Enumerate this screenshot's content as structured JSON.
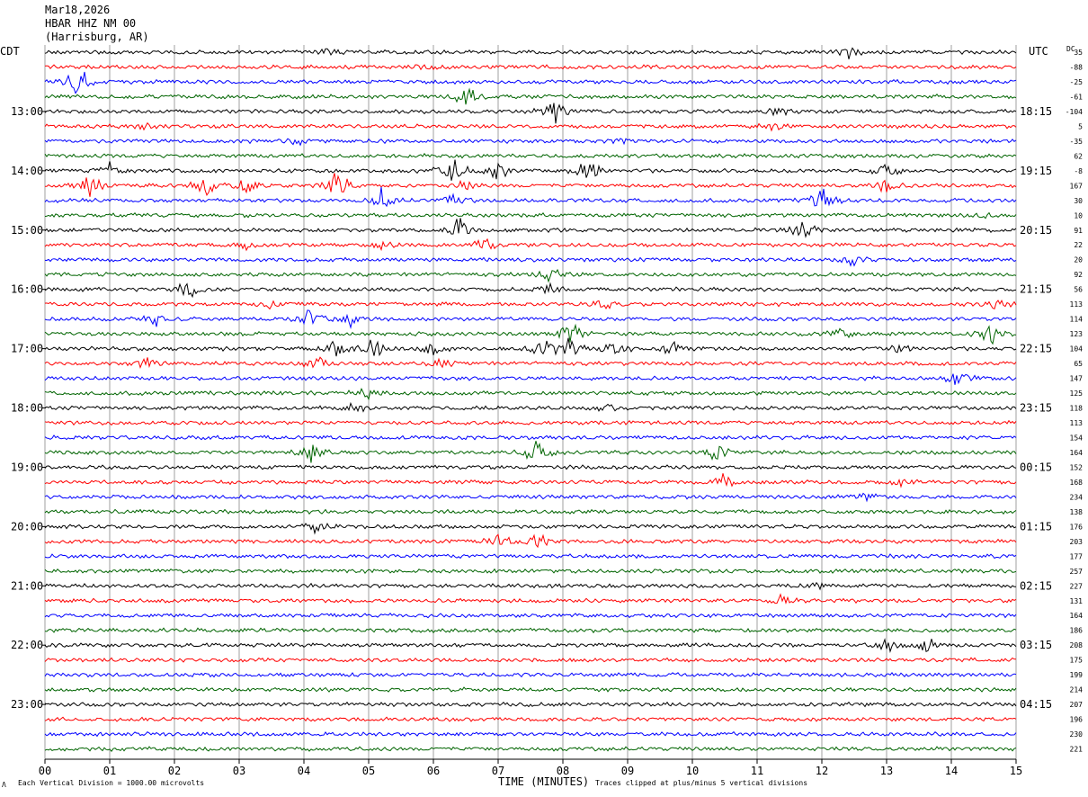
{
  "header": {
    "date": "Mar18,2026",
    "station": "HBAR HHZ NM 00",
    "location": "(Harrisburg, AR)"
  },
  "left_zone": "CDT",
  "right_zone": "UTC",
  "dc_label": "DC",
  "footer": {
    "vertical_division": "Each Vertical Division = 1000.00 microvolts",
    "xlabel": "TIME (MINUTES)",
    "clip_note": "Traces clipped at plus/minus 5 vertical divisions",
    "corner_mark": "Λ"
  },
  "chart_data": {
    "type": "line",
    "title": "HBAR HHZ NM 00",
    "xlabel": "TIME (MINUTES)",
    "ylabel": "",
    "xlim": [
      0,
      15
    ],
    "x_ticks": [
      "00",
      "01",
      "02",
      "03",
      "04",
      "05",
      "06",
      "07",
      "08",
      "09",
      "10",
      "11",
      "12",
      "13",
      "14",
      "15"
    ],
    "trace_count": 48,
    "trace_colors": [
      "#000000",
      "#ff0000",
      "#0000ff",
      "#006400"
    ],
    "left_hour_labels": [
      "13:00",
      "14:00",
      "15:00",
      "16:00",
      "17:00",
      "18:00",
      "19:00",
      "20:00",
      "21:00",
      "22:00",
      "23:00"
    ],
    "right_hour_labels": [
      "18:15",
      "19:15",
      "20:15",
      "21:15",
      "22:15",
      "23:15",
      "00:15",
      "01:15",
      "02:15",
      "03:15",
      "04:15"
    ],
    "dc_offsets": [
      "35",
      "-88",
      "-25",
      "-61",
      "-104",
      "5",
      "-35",
      "62",
      "-8",
      "167",
      "30",
      "10",
      "91",
      "22",
      "20",
      "92",
      "56",
      "113",
      "114",
      "123",
      "104",
      "65",
      "147",
      "125",
      "118",
      "113",
      "154",
      "164",
      "152",
      "168",
      "234",
      "138",
      "176",
      "203",
      "177",
      "257",
      "227",
      "131",
      "164",
      "186",
      "208",
      "175",
      "199",
      "214",
      "207",
      "196",
      "230",
      "221"
    ],
    "events": [
      {
        "trace": 0,
        "minute": 4.4,
        "amp": 1.2
      },
      {
        "trace": 0,
        "minute": 12.4,
        "amp": 1.5
      },
      {
        "trace": 1,
        "minute": 5.9,
        "amp": 0.9
      },
      {
        "trace": 2,
        "minute": 0.5,
        "amp": 4.5
      },
      {
        "trace": 3,
        "minute": 6.5,
        "amp": 3.5
      },
      {
        "trace": 4,
        "minute": 7.9,
        "amp": 3.0
      },
      {
        "trace": 4,
        "minute": 11.3,
        "amp": 1.8
      },
      {
        "trace": 5,
        "minute": 1.5,
        "amp": 1.2
      },
      {
        "trace": 5,
        "minute": 11.3,
        "amp": 1.2
      },
      {
        "trace": 6,
        "minute": 3.9,
        "amp": 1.0
      },
      {
        "trace": 6,
        "minute": 8.9,
        "amp": 1.0
      },
      {
        "trace": 8,
        "minute": 6.3,
        "amp": 4.5
      },
      {
        "trace": 8,
        "minute": 8.4,
        "amp": 4.5
      },
      {
        "trace": 8,
        "minute": 7.0,
        "amp": 3.0
      },
      {
        "trace": 8,
        "minute": 13.0,
        "amp": 2.5
      },
      {
        "trace": 8,
        "minute": 1.0,
        "amp": 1.5
      },
      {
        "trace": 9,
        "minute": 0.7,
        "amp": 4.0
      },
      {
        "trace": 9,
        "minute": 2.5,
        "amp": 3.5
      },
      {
        "trace": 9,
        "minute": 3.1,
        "amp": 3.0
      },
      {
        "trace": 9,
        "minute": 4.5,
        "amp": 5.0
      },
      {
        "trace": 9,
        "minute": 6.5,
        "amp": 1.5
      },
      {
        "trace": 9,
        "minute": 13.0,
        "amp": 2.5
      },
      {
        "trace": 10,
        "minute": 5.2,
        "amp": 3.5
      },
      {
        "trace": 10,
        "minute": 6.3,
        "amp": 2.0
      },
      {
        "trace": 10,
        "minute": 12.0,
        "amp": 4.0
      },
      {
        "trace": 11,
        "minute": 14.5,
        "amp": 1.0
      },
      {
        "trace": 12,
        "minute": 6.4,
        "amp": 4.0
      },
      {
        "trace": 12,
        "minute": 11.7,
        "amp": 3.5
      },
      {
        "trace": 13,
        "minute": 3.1,
        "amp": 1.0
      },
      {
        "trace": 13,
        "minute": 5.2,
        "amp": 1.2
      },
      {
        "trace": 13,
        "minute": 6.8,
        "amp": 2.0
      },
      {
        "trace": 14,
        "minute": 12.5,
        "amp": 1.5
      },
      {
        "trace": 15,
        "minute": 7.8,
        "amp": 2.0
      },
      {
        "trace": 16,
        "minute": 2.2,
        "amp": 3.0
      },
      {
        "trace": 16,
        "minute": 7.8,
        "amp": 1.5
      },
      {
        "trace": 17,
        "minute": 3.5,
        "amp": 1.2
      },
      {
        "trace": 17,
        "minute": 8.6,
        "amp": 2.0
      },
      {
        "trace": 17,
        "minute": 14.7,
        "amp": 2.0
      },
      {
        "trace": 18,
        "minute": 1.7,
        "amp": 2.5
      },
      {
        "trace": 18,
        "minute": 4.1,
        "amp": 3.5
      },
      {
        "trace": 18,
        "minute": 4.7,
        "amp": 2.0
      },
      {
        "trace": 19,
        "minute": 8.1,
        "amp": 4.0
      },
      {
        "trace": 19,
        "minute": 12.3,
        "amp": 1.5
      },
      {
        "trace": 19,
        "minute": 14.6,
        "amp": 3.0
      },
      {
        "trace": 20,
        "minute": 4.5,
        "amp": 3.0
      },
      {
        "trace": 20,
        "minute": 5.1,
        "amp": 3.0
      },
      {
        "trace": 20,
        "minute": 6.0,
        "amp": 2.0
      },
      {
        "trace": 20,
        "minute": 7.7,
        "amp": 3.0
      },
      {
        "trace": 20,
        "minute": 8.1,
        "amp": 3.5
      },
      {
        "trace": 20,
        "minute": 8.8,
        "amp": 3.0
      },
      {
        "trace": 20,
        "minute": 9.7,
        "amp": 2.0
      },
      {
        "trace": 20,
        "minute": 13.2,
        "amp": 1.5
      },
      {
        "trace": 21,
        "minute": 1.6,
        "amp": 2.0
      },
      {
        "trace": 21,
        "minute": 4.2,
        "amp": 2.0
      },
      {
        "trace": 21,
        "minute": 6.1,
        "amp": 1.5
      },
      {
        "trace": 22,
        "minute": 14.1,
        "amp": 2.5
      },
      {
        "trace": 23,
        "minute": 5.0,
        "amp": 1.5
      },
      {
        "trace": 24,
        "minute": 4.8,
        "amp": 1.2
      },
      {
        "trace": 24,
        "minute": 8.7,
        "amp": 1.0
      },
      {
        "trace": 27,
        "minute": 4.1,
        "amp": 3.0
      },
      {
        "trace": 27,
        "minute": 7.6,
        "amp": 4.0
      },
      {
        "trace": 27,
        "minute": 10.4,
        "amp": 3.5
      },
      {
        "trace": 29,
        "minute": 10.5,
        "amp": 2.0
      },
      {
        "trace": 29,
        "minute": 13.2,
        "amp": 1.0
      },
      {
        "trace": 30,
        "minute": 12.7,
        "amp": 1.0
      },
      {
        "trace": 32,
        "minute": 4.2,
        "amp": 1.5
      },
      {
        "trace": 33,
        "minute": 7.0,
        "amp": 2.5
      },
      {
        "trace": 33,
        "minute": 7.6,
        "amp": 2.5
      },
      {
        "trace": 36,
        "minute": 11.9,
        "amp": 1.2
      },
      {
        "trace": 37,
        "minute": 11.4,
        "amp": 1.5
      },
      {
        "trace": 40,
        "minute": 13.0,
        "amp": 2.0
      },
      {
        "trace": 40,
        "minute": 13.6,
        "amp": 2.5
      }
    ]
  }
}
